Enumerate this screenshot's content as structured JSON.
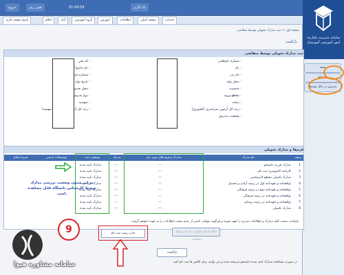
{
  "sidebar": {
    "university_name": "سامانه مدیریت یکپارچه امور آموزشی آموزشیار",
    "items": [
      {
        "label": "نتیجه"
      },
      {
        "label": "ثبت‌نام"
      },
      {
        "label": "پذیرش در حال توسط"
      }
    ]
  },
  "topbar": {
    "items": [
      {
        "label": "خروج"
      },
      {
        "label": "تغییر رمز"
      },
      {
        "label": "01:04:59"
      },
      {
        "label": "نام کاربر"
      }
    ]
  },
  "tabs": [
    "خدمات",
    "صفحه اصلی",
    "اطلاعات",
    "اموزش",
    "گروه آموزشی",
    "آمار",
    "اعلام",
    "پاسخ صفحه جاری"
  ],
  "breadcrumb": "صفحه اول > ثبت مدارک تحویلی توسط متقاضی",
  "return_link": "بازگشت",
  "info_panel": {
    "title": "ثبت مدارک تحویلی توسط متقاضی",
    "right_fields": [
      "شماره داوطلبی :",
      "نام :",
      "نام پدر :",
      "محل تولد :",
      "جنسیت :",
      "مقطع ورود :",
      "رشته :",
      "رتبه کل آزمون سراسری (کشوری) :",
      "وضعیت پذیرش :"
    ],
    "left_fields": [
      "کد ملی :",
      "نام خانوادگی :",
      "شماره شناسنامه :",
      "تاریخ تولد :",
      "محل صدور شناسنامه :",
      "نوع پذیرش :",
      "سهمیه :",
      "رتبه کل آزمون سراسری (سهمیه) :"
    ]
  },
  "docs": {
    "title": "فرم‌ها و مدارک تحویلی",
    "headers": [
      "ردیف",
      "نام مدرک",
      "مدارک و فرم های مورد نیاز",
      "مدرک",
      "وضعیت ثبت",
      "توضیحات ادرایی",
      "شرح اصلاح"
    ],
    "rows": [
      {
        "no": "1",
        "name": "مدارک فرزند دانشجو",
        "status": "مدارک تایید شده"
      },
      {
        "no": "2",
        "name": "کارنامه کامپیوتری ثبت نام",
        "status": "مدارک تایید شده"
      },
      {
        "no": "3",
        "name": "مدارک تکمیلی مقطع کارشناسی",
        "status": "مدارک تایید شده"
      },
      {
        "no": "4",
        "name": "توافقنامه و تعهدنامه اول در زمینه آزادی و تحصیل",
        "status": "مدارک تایید شده"
      },
      {
        "no": "5",
        "name": "توافقنامه و تعهدنامه دوم در زمینه فرهنگی",
        "status": "مدارک تایید شده"
      },
      {
        "no": "6",
        "name": "توافقنامه و تعهدنامه در زمینه فرهنگی",
        "status": "مدارک تایید شده"
      },
      {
        "no": "7",
        "name": "توافقنامه و تعهدنامه در زمینه پزشکی",
        "status": "مدارک تایید شده"
      },
      {
        "no": "8",
        "name": "مدارک تکمیلی",
        "status": "مدارک تایید شده"
      }
    ],
    "dash": "---",
    "annotation": "در این ستون وضعیت بررسی مدارک توسط کارشناس دانشگاه قابل مشاهده است."
  },
  "notice": "اینجانب صحت کلیه مدارک و اطلاعات مندرج را تعهد نموده و هرگونه عواقب ناشی از عدم صحت اطلاعات را به عهده خواهم گرفت.",
  "buttons": {
    "register": "اعلام اتمام تحویل مدارک توسط متقاضی",
    "print": "چاپ رسید ثبت نام",
    "back": "بازگشت"
  },
  "step_number": "9",
  "bottom_note": "در صورت مشاهده مدارک تایید شده دانشجو پذیرفته شده و می توانید برای کلاس ها ثبت نام کنید",
  "watermark": "سامانه مشاوره هیوا",
  "colors": {
    "accent": "#3f6db3",
    "highlight_green": "#2faa3c",
    "highlight_red": "#d8222a",
    "highlight_orange": "#f08a24"
  }
}
